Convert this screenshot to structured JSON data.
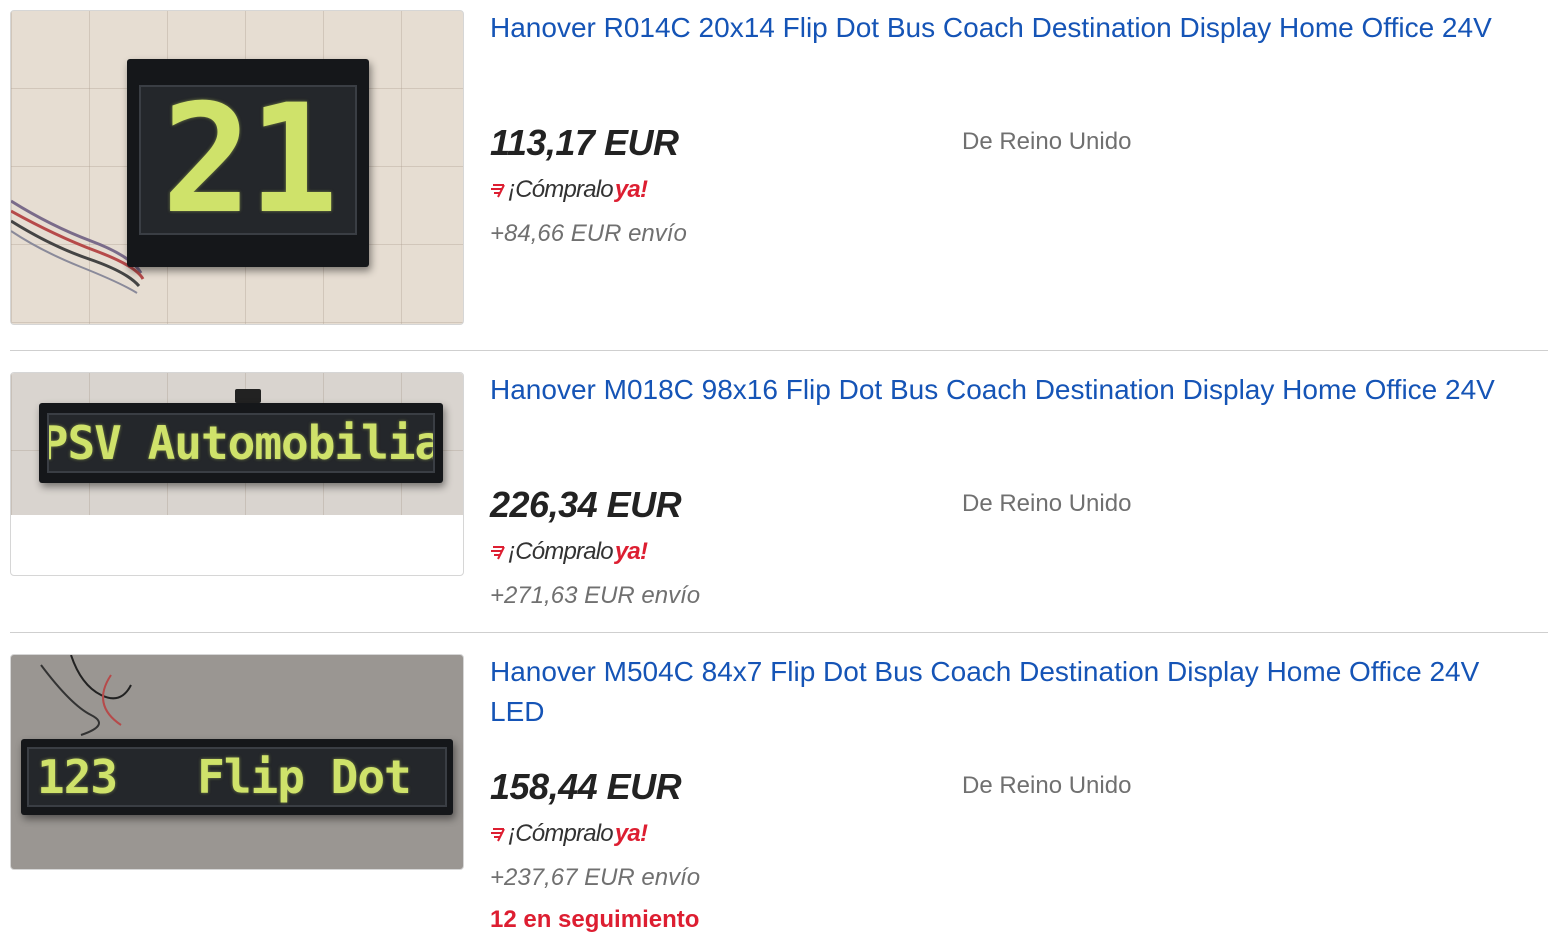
{
  "listings": [
    {
      "title": "Hanover R014C 20x14 Flip Dot Bus Coach Destination Display Home Office 24V",
      "price": "113,17 EUR",
      "buy_now": {
        "prefix": "¡Cómpralo",
        "suffix": "ya!"
      },
      "shipping": "+84,66 EUR envío",
      "location": "De Reino Unido",
      "display_text": "21"
    },
    {
      "title": "Hanover M018C 98x16 Flip Dot Bus Coach Destination Display Home Office 24V",
      "price": "226,34 EUR",
      "buy_now": {
        "prefix": "¡Cómpralo",
        "suffix": "ya!"
      },
      "shipping": "+271,63 EUR envío",
      "location": "De Reino Unido",
      "display_text": "PSV Automobilia"
    },
    {
      "title": "Hanover M504C 84x7 Flip Dot Bus Coach Destination Display Home Office 24V LED",
      "price": "158,44 EUR",
      "buy_now": {
        "prefix": "¡Cómpralo",
        "suffix": "ya!"
      },
      "shipping": "+237,67 EUR envío",
      "location": "De Reino Unido",
      "watchers": "12 en seguimiento",
      "display_text": "123   Flip Dot"
    }
  ],
  "colors": {
    "title_link": "#1554b6",
    "buy_now_accent": "#dd1e31",
    "muted": "#707070",
    "dot_yellow": "#cfe26a"
  },
  "icons": [
    "buy-now-icon"
  ]
}
